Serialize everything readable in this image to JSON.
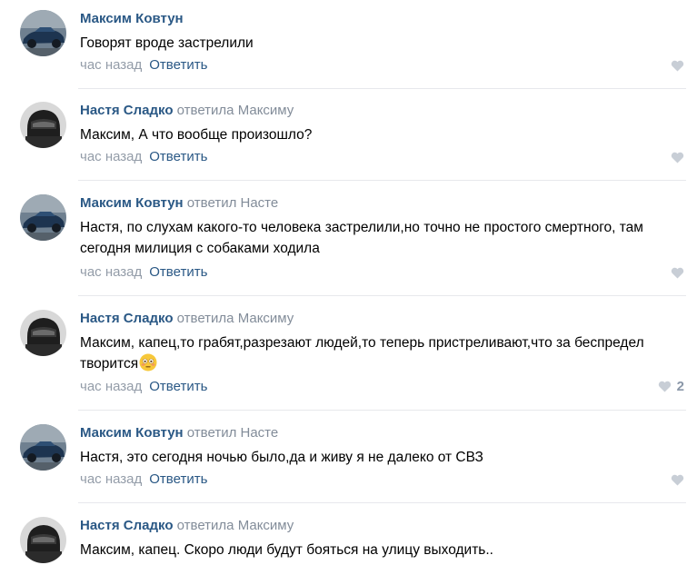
{
  "comments": [
    {
      "author": "Максим Ковтун",
      "reply_to": "",
      "text": "Говорят вроде застрелили",
      "time": "час назад",
      "reply_label": "Ответить",
      "likes": "",
      "avatar_icon": "car-avatar-icon"
    },
    {
      "author": "Настя Сладко",
      "reply_to": "ответила Максиму",
      "text": "Максим, А что вообще произошло?",
      "time": "час назад",
      "reply_label": "Ответить",
      "likes": "",
      "avatar_icon": "helmet-avatar-icon"
    },
    {
      "author": "Максим Ковтун",
      "reply_to": "ответил Насте",
      "text": "Настя, по слухам какого-то человека застрелили,но точно не простого смертного, там сегодня милиция с собаками ходила",
      "time": "час назад",
      "reply_label": "Ответить",
      "likes": "",
      "avatar_icon": "car-avatar-icon"
    },
    {
      "author": "Настя Сладко",
      "reply_to": "ответила Максиму",
      "text": "Максим, капец,то грабят,разрезают людей,то теперь пристреливают,что за беспредел творится",
      "emoji": "flushed-face-emoji",
      "time": "час назад",
      "reply_label": "Ответить",
      "likes": "2",
      "avatar_icon": "helmet-avatar-icon"
    },
    {
      "author": "Максим Ковтун",
      "reply_to": "ответил Насте",
      "text": "Настя, это сегодня ночью было,да и живу я не далеко от СВЗ",
      "time": "час назад",
      "reply_label": "Ответить",
      "likes": "",
      "avatar_icon": "car-avatar-icon"
    },
    {
      "author": "Настя Сладко",
      "reply_to": "ответила Максиму",
      "text": "Максим, капец. Скоро люди будут бояться на улицу выходить..",
      "time": "",
      "reply_label": "",
      "likes": "",
      "avatar_icon": "helmet-avatar-icon"
    }
  ],
  "colors": {
    "author": "#2a5885",
    "muted": "#828c99",
    "like": "#8a97a8",
    "divider": "#e7e8ec"
  }
}
